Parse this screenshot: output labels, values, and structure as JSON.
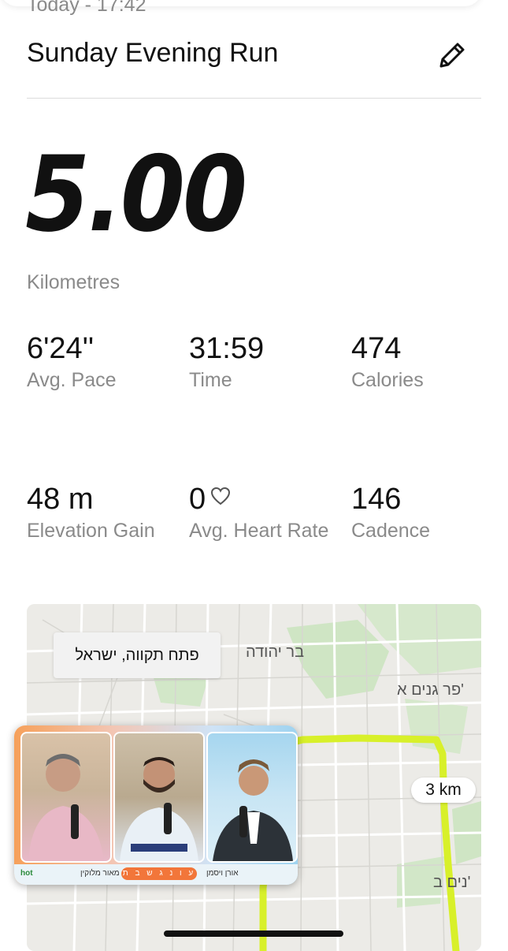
{
  "header": {
    "date_time": "Today - 17:42",
    "title": "Sunday Evening Run",
    "edit_icon": "pencil-icon"
  },
  "summary": {
    "distance": "5.00",
    "unit": "Kilometres"
  },
  "stats": [
    {
      "value": "6'24''",
      "label": "Avg. Pace"
    },
    {
      "value": "31:59",
      "label": "Time"
    },
    {
      "value": "474",
      "label": "Calories"
    },
    {
      "value": "48 m",
      "label": "Elevation Gain"
    },
    {
      "value": "0",
      "label": "Avg. Heart Rate",
      "icon": "heart-icon"
    },
    {
      "value": "146",
      "label": "Cadence"
    }
  ],
  "map": {
    "popup": "פתח תקווה, ישראל",
    "labels": [
      "בר יהודה",
      "פר גנים א'",
      "נים ב'"
    ],
    "km_marker": "3 km",
    "route_color": "#d8f02a"
  },
  "video_overlay": {
    "bottom_pill": "ע ו נ ג ש ב ת",
    "bottom_left_text": "אורן ויסמן",
    "bottom_mid_text": "מאור מלוקין",
    "brand": "hot"
  },
  "colors": {
    "text": "#111111",
    "muted": "#8a8a8a",
    "divider": "#dcdcdc"
  }
}
